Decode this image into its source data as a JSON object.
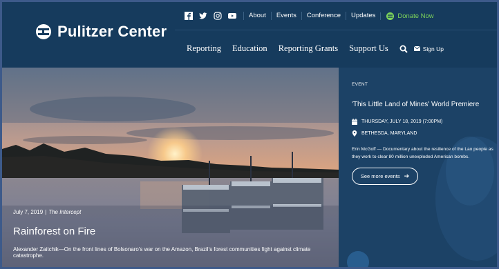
{
  "brand": {
    "name": "Pulitzer Center"
  },
  "topbar": {
    "social_icons": [
      "facebook-icon",
      "twitter-icon",
      "instagram-icon",
      "youtube-icon"
    ],
    "links": [
      "About",
      "Events",
      "Conference",
      "Updates"
    ],
    "donate_label": "Donate Now"
  },
  "nav": {
    "items": [
      "Reporting",
      "Education",
      "Reporting Grants",
      "Support Us"
    ],
    "signup_label": "Sign Up"
  },
  "hero": {
    "date": "July 7, 2019",
    "source": "The Intercept",
    "title": "Rainforest on Fire",
    "description": "Alexander Zaitchik—On the front lines of Bolsonaro's war on the Amazon, Brazil's forest communities fight against climate catastrophe."
  },
  "event": {
    "tag": "EVENT",
    "title": "'This Little Land of Mines' World Premiere",
    "date": "THURSDAY, JULY 18, 2019 (7:00PM)",
    "location": "BETHESDA, MARYLAND",
    "description": "Erin McGoff — Documentary about the resilience of the Lao people as they work to clear 80 million unexploded American bombs.",
    "button_label": "See more events"
  },
  "colors": {
    "navy": "#163b5d",
    "donate_green": "#7dd35a"
  }
}
